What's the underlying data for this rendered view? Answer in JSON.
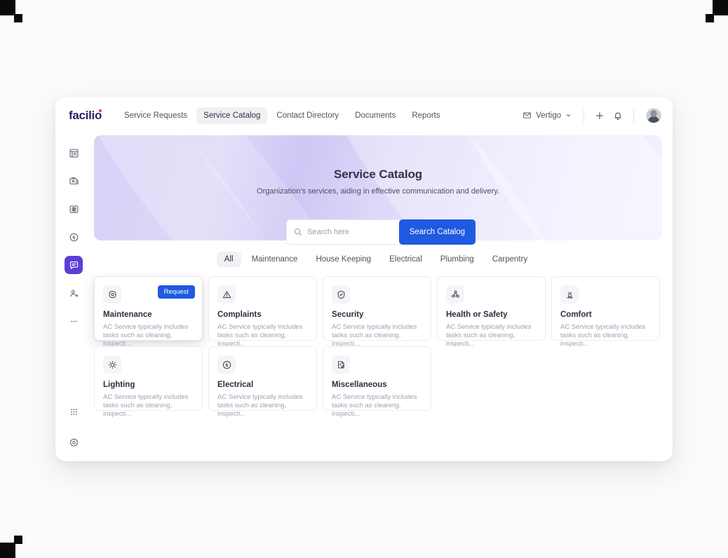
{
  "header": {
    "logo": "facilio",
    "nav": [
      {
        "label": "Service Requests",
        "active": false
      },
      {
        "label": "Service Catalog",
        "active": true
      },
      {
        "label": "Contact Directory",
        "active": false
      },
      {
        "label": "Documents",
        "active": false
      },
      {
        "label": "Reports",
        "active": false
      }
    ],
    "site_selector": {
      "label": "Vertigo",
      "icon": "site-icon",
      "chevron": "chevron-down-icon"
    },
    "add_icon": "plus-icon",
    "notification_icon": "bell-icon",
    "avatar": "user-avatar"
  },
  "sidebar": {
    "items": [
      {
        "name": "sidebar-item-dashboard",
        "icon": "dashboard-icon",
        "active": false
      },
      {
        "name": "sidebar-item-assets",
        "icon": "assets-icon",
        "active": false
      },
      {
        "name": "sidebar-item-contacts",
        "icon": "id-card-icon",
        "active": false
      },
      {
        "name": "sidebar-item-energy",
        "icon": "energy-icon",
        "active": false
      },
      {
        "name": "sidebar-item-service-catalog",
        "icon": "chat-icon",
        "active": true
      },
      {
        "name": "sidebar-item-people",
        "icon": "people-icon",
        "active": false
      },
      {
        "name": "sidebar-item-more",
        "icon": "more-dots-icon",
        "active": false
      }
    ],
    "bottom": [
      {
        "name": "sidebar-item-apps",
        "icon": "grid-apps-icon"
      },
      {
        "name": "sidebar-item-settings",
        "icon": "gear-icon"
      }
    ]
  },
  "hero": {
    "title": "Service Catalog",
    "subtitle": "Organization's services, aiding in effective communication and delivery."
  },
  "search": {
    "placeholder": "Search here",
    "value": "",
    "icon": "search-icon",
    "button_label": "Search Catalog"
  },
  "filters": {
    "tabs": [
      {
        "label": "All",
        "active": true
      },
      {
        "label": "Maintenance",
        "active": false
      },
      {
        "label": "House Keeping",
        "active": false
      },
      {
        "label": "Electrical",
        "active": false
      },
      {
        "label": "Plumbing",
        "active": false
      },
      {
        "label": "Carpentry",
        "active": false
      }
    ]
  },
  "catalog": {
    "request_badge_label": "Request",
    "rows": [
      [
        {
          "title": "Maintenance",
          "desc": "AC Service typically includes tasks such as cleaning, inspecti...",
          "icon": "gear-cog-icon",
          "badge": true,
          "raised": true
        },
        {
          "title": "Complaints",
          "desc": "AC Service typically includes tasks such as cleaning, inspecti...",
          "icon": "warning-triangle-icon",
          "badge": false,
          "raised": false
        },
        {
          "title": "Security",
          "desc": "AC Service typically includes tasks such as cleaning, inspecti...",
          "icon": "shield-check-icon",
          "badge": false,
          "raised": false
        },
        {
          "title": "Health or Safety",
          "desc": "AC Service typically includes tasks such as cleaning, inspecti...",
          "icon": "health-safety-icon",
          "badge": false,
          "raised": false
        },
        {
          "title": "Comfort",
          "desc": "AC Service typically includes tasks such as cleaning, inspecti...",
          "icon": "comfort-icon",
          "badge": false,
          "raised": false
        }
      ],
      [
        {
          "title": "Lighting",
          "desc": "AC Service typically includes tasks such as cleaning, inspecti...",
          "icon": "sun-brightness-icon",
          "badge": false,
          "raised": false
        },
        {
          "title": "Electrical",
          "desc": "AC Service typically includes tasks such as cleaning, inspecti...",
          "icon": "lightning-circle-icon",
          "badge": false,
          "raised": false
        },
        {
          "title": "Miscellaneous",
          "desc": "AC Service typically includes tasks such as cleaning, inspecti...",
          "icon": "document-edit-icon",
          "badge": false,
          "raised": false
        }
      ]
    ]
  },
  "colors": {
    "accent_blue": "#1f5ae0",
    "sidebar_active_purple": "#5b3fd6",
    "logo_navy": "#2b2064",
    "logo_pink": "#e9308a",
    "hero_lavender": "#d9d1f7"
  }
}
